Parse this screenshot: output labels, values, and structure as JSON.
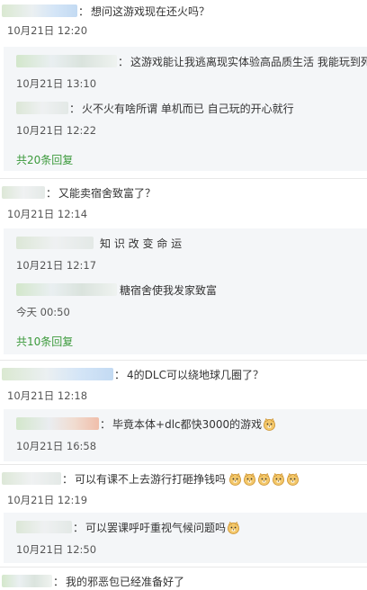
{
  "comments": [
    {
      "text": "想问这游戏现在还火吗？",
      "time": "10月21日 12:20",
      "replies": [
        {
          "text": "这游戏能让我逃离现实体验高品质生活 我能玩到死",
          "time": "10月21日 13:10"
        },
        {
          "text": "火不火有啥所谓 单机而已 自己玩的开心就行",
          "time": "10月21日 12:22"
        }
      ],
      "more": "共20条回复"
    },
    {
      "text": "又能卖宿舍致富了？",
      "time": "10月21日 12:14",
      "replies": [
        {
          "text": "知 识 改 变 命 运",
          "time": "10月21日 12:17"
        },
        {
          "text": "糖宿舍使我发家致富",
          "time": "今天 00:50"
        }
      ],
      "more": "共10条回复"
    },
    {
      "text": "4的DLC可以绕地球几圈了？",
      "time": "10月21日 12:18",
      "replies": [
        {
          "text": "毕竟本体+dlc都快3000的游戏",
          "time": "10月21日 16:58"
        }
      ]
    },
    {
      "text": "可以有课不上去游行打砸挣钱吗",
      "time": "10月21日 12:19"
    },
    {
      "text": "",
      "replies": [
        {
          "text": "可以罢课呼吁重视气候问题吗",
          "time": "10月21日 12:50"
        }
      ]
    },
    {
      "text": "我的邪恶包已经准备好了"
    }
  ],
  "colors": {
    "link_green": "#3c9a3c",
    "reply_bg": "#f4f6f8"
  },
  "icons": {
    "emoji": "doge-emoji"
  }
}
